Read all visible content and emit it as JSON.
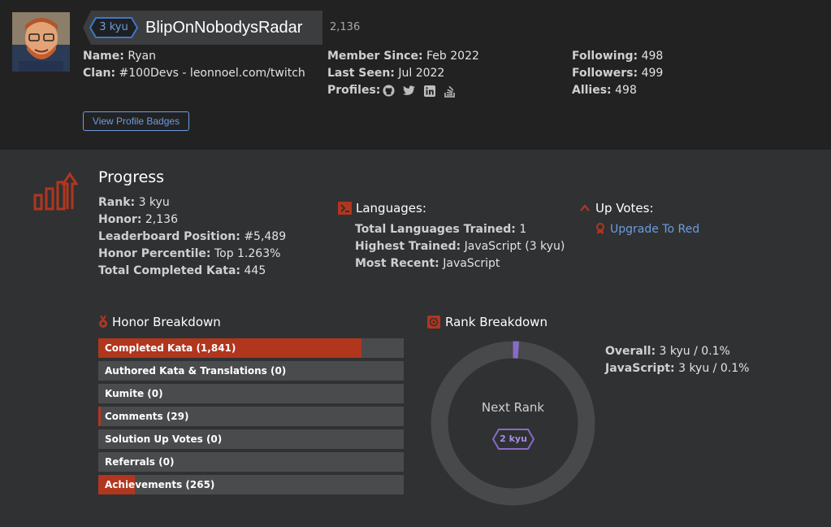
{
  "profile": {
    "rank": "3 kyu",
    "username": "BlipOnNobodysRadar",
    "honor_score": "2,136",
    "info": {
      "name_label": "Name:",
      "name_value": "Ryan",
      "clan_label": "Clan:",
      "clan_value": "#100Devs - leonnoel.com/twitch",
      "member_since_label": "Member Since:",
      "member_since_value": "Feb 2022",
      "last_seen_label": "Last Seen:",
      "last_seen_value": "Jul 2022",
      "profiles_label": "Profiles:",
      "following_label": "Following:",
      "following_value": "498",
      "followers_label": "Followers:",
      "followers_value": "499",
      "allies_label": "Allies:",
      "allies_value": "498"
    },
    "profile_icons": [
      "github-icon",
      "twitter-icon",
      "linkedin-icon",
      "stackoverflow-icon"
    ],
    "view_badges_button": "View Profile Badges"
  },
  "progress": {
    "title": "Progress",
    "stats": {
      "rank_label": "Rank:",
      "rank_value": "3 kyu",
      "honor_label": "Honor:",
      "honor_value": "2,136",
      "leaderboard_label": "Leaderboard Position:",
      "leaderboard_value": "#5,489",
      "percentile_label": "Honor Percentile:",
      "percentile_value": "Top 1.263%",
      "kata_label": "Total Completed Kata:",
      "kata_value": "445"
    },
    "languages": {
      "title": "Languages:",
      "trained_label": "Total Languages Trained:",
      "trained_value": "1",
      "highest_label": "Highest Trained:",
      "highest_value": "JavaScript (3 kyu)",
      "recent_label": "Most Recent:",
      "recent_value": "JavaScript"
    },
    "upvotes": {
      "title": "Up Votes:",
      "upgrade_link": "Upgrade To Red"
    }
  },
  "honor_breakdown": {
    "title": "Honor Breakdown",
    "bars": [
      {
        "label": "Completed Kata (1,841)",
        "fill": 0.862
      },
      {
        "label": "Authored Kata & Translations (0)",
        "fill": 0
      },
      {
        "label": "Kumite (0)",
        "fill": 0
      },
      {
        "label": "Comments (29)",
        "fill": 0.008
      },
      {
        "label": "Solution Up Votes (0)",
        "fill": 0
      },
      {
        "label": "Referrals (0)",
        "fill": 0
      },
      {
        "label": "Achievements (265)",
        "fill": 0.121
      }
    ]
  },
  "rank_breakdown": {
    "title": "Rank Breakdown",
    "next_rank_label": "Next Rank",
    "next_rank": "2 kyu",
    "progress_fraction": 0.012,
    "overall_label": "Overall:",
    "overall_value": "3 kyu / 0.1%",
    "js_label": "JavaScript:",
    "js_value": "3 kyu / 0.1%"
  },
  "colors": {
    "accent_red": "#b1361e",
    "link_blue": "#6c9ddf",
    "rank_purple": "#866cc7",
    "bg": "#303133",
    "header_bg": "#222223"
  }
}
